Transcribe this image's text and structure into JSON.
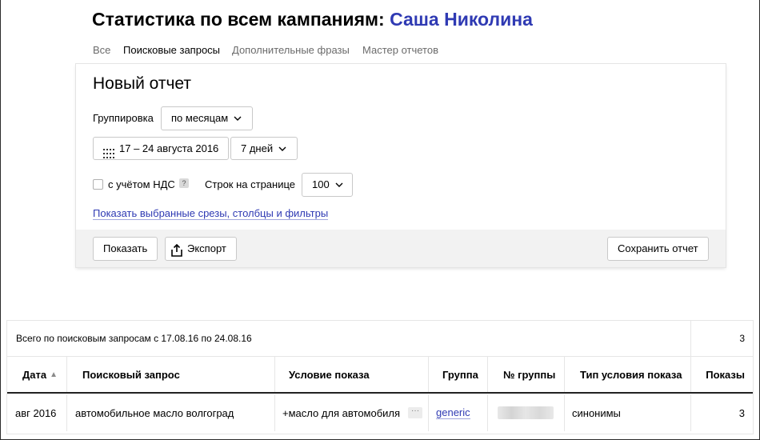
{
  "page": {
    "title_prefix": "Статистика по всем кампаниям:",
    "client_name": "Саша Николина"
  },
  "tabs": [
    {
      "label": "Все",
      "active": false
    },
    {
      "label": "Поисковые запросы",
      "active": true
    },
    {
      "label": "Дополнительные фразы",
      "active": false
    },
    {
      "label": "Мастер отчетов",
      "active": false
    }
  ],
  "report": {
    "title": "Новый отчет",
    "grouping_label": "Группировка",
    "grouping_value": "по месяцам",
    "date_range": "17 – 24 августа 2016",
    "period_value": "7 дней",
    "vat_label": "с учётом НДС",
    "vat_checked": false,
    "help_glyph": "?",
    "rows_label": "Строк на странице",
    "rows_value": "100",
    "filters_link": "Показать выбранные срезы, столбцы и фильтры",
    "show_button": "Показать",
    "export_button": "Экспорт",
    "save_button": "Сохранить отчет"
  },
  "table": {
    "summary_text": "Всего по поисковым запросам с 17.08.16 по 24.08.16",
    "summary_total": "3",
    "columns": [
      "Дата",
      "Поисковый запрос",
      "Условие показа",
      "Группа",
      "№ группы",
      "Тип условия показа",
      "Показы"
    ],
    "sort_indicator": "▲",
    "rows": [
      {
        "date": "авг 2016",
        "query": "автомобильное масло волгоград",
        "condition": "+масло для автомобиля",
        "condition_more": "···",
        "group": "generic",
        "group_number_redacted": true,
        "condition_type": "синонимы",
        "impressions": "3"
      }
    ]
  },
  "colors": {
    "accent_link": "#2f3ab3",
    "active_tab_underline": "#e62a1b",
    "footer_bg": "#f2f2f2"
  }
}
